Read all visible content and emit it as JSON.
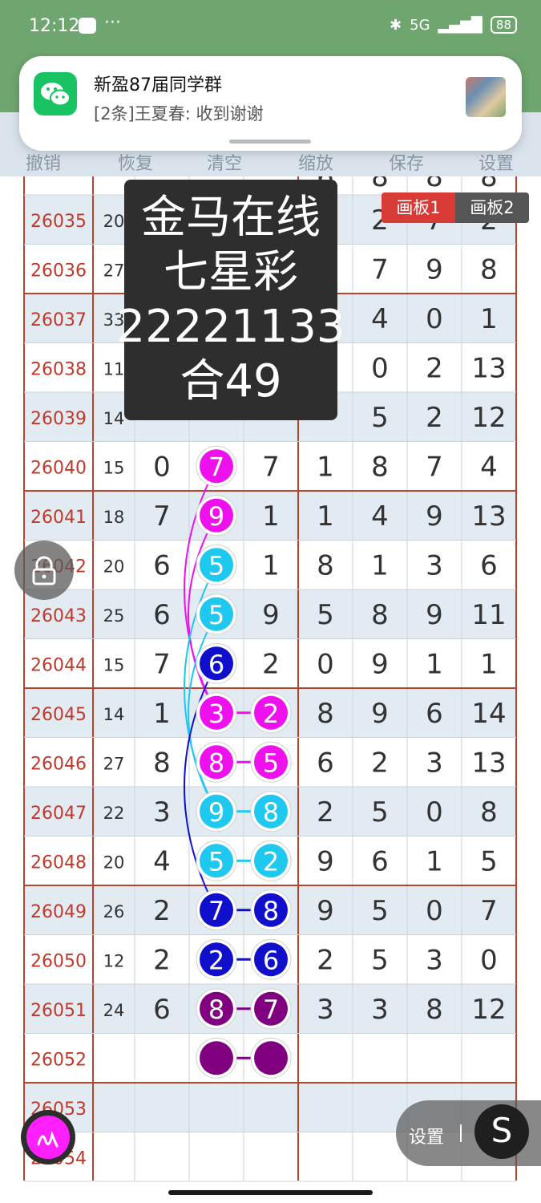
{
  "status_bar": {
    "time": "12:12",
    "more": "···",
    "signal": "5G",
    "battery": "88"
  },
  "notification": {
    "title": "新盈87届同学群",
    "message": "[2条]王夏春: 收到谢谢"
  },
  "toolbar": {
    "items": [
      "撤销",
      "恢复",
      "清空",
      "缩放",
      "保存",
      "设置"
    ]
  },
  "tabs": [
    "画板1",
    "画板2"
  ],
  "overlay": {
    "lines": [
      "金马在线",
      "七星彩",
      "22221133",
      "合49"
    ]
  },
  "columns_partial": [
    "6",
    "8",
    "8",
    "8"
  ],
  "rows": [
    {
      "id": "26035",
      "sum": "20",
      "d": [
        "",
        "",
        "",
        "",
        "2",
        "7",
        "2"
      ]
    },
    {
      "id": "26036",
      "sum": "27",
      "d": [
        "",
        "",
        "",
        "",
        "7",
        "9",
        "8"
      ]
    },
    {
      "id": "26037",
      "sum": "33",
      "d": [
        "",
        "",
        "",
        "",
        "4",
        "0",
        "1"
      ]
    },
    {
      "id": "26038",
      "sum": "11",
      "d": [
        "",
        "",
        "",
        "",
        "0",
        "2",
        "13"
      ]
    },
    {
      "id": "26039",
      "sum": "14",
      "d": [
        "",
        "",
        "",
        "",
        "5",
        "2",
        "12"
      ]
    },
    {
      "id": "26040",
      "sum": "15",
      "d": [
        "0",
        "7",
        "7",
        "1",
        "8",
        "7",
        "4"
      ]
    },
    {
      "id": "26041",
      "sum": "18",
      "d": [
        "7",
        "9",
        "1",
        "1",
        "4",
        "9",
        "13"
      ]
    },
    {
      "id": "26042",
      "sum": "20",
      "d": [
        "6",
        "5",
        "1",
        "8",
        "1",
        "3",
        "6"
      ]
    },
    {
      "id": "26043",
      "sum": "25",
      "d": [
        "6",
        "5",
        "9",
        "5",
        "8",
        "9",
        "11"
      ]
    },
    {
      "id": "26044",
      "sum": "15",
      "d": [
        "7",
        "6",
        "2",
        "0",
        "9",
        "1",
        "1"
      ]
    },
    {
      "id": "26045",
      "sum": "14",
      "d": [
        "1",
        "3",
        "2",
        "8",
        "9",
        "6",
        "14"
      ]
    },
    {
      "id": "26046",
      "sum": "27",
      "d": [
        "8",
        "8",
        "5",
        "6",
        "2",
        "3",
        "13"
      ]
    },
    {
      "id": "26047",
      "sum": "22",
      "d": [
        "3",
        "9",
        "8",
        "2",
        "5",
        "0",
        "8"
      ]
    },
    {
      "id": "26048",
      "sum": "20",
      "d": [
        "4",
        "5",
        "2",
        "9",
        "6",
        "1",
        "5"
      ]
    },
    {
      "id": "26049",
      "sum": "26",
      "d": [
        "2",
        "7",
        "8",
        "9",
        "5",
        "0",
        "7"
      ]
    },
    {
      "id": "26050",
      "sum": "12",
      "d": [
        "2",
        "2",
        "6",
        "2",
        "5",
        "3",
        "0"
      ]
    },
    {
      "id": "26051",
      "sum": "24",
      "d": [
        "6",
        "8",
        "7",
        "3",
        "3",
        "8",
        "12"
      ]
    },
    {
      "id": "26052",
      "sum": "",
      "d": [
        "",
        "",
        "",
        "",
        "",
        "",
        ""
      ]
    },
    {
      "id": "26053",
      "sum": "",
      "d": [
        "",
        "",
        "",
        "",
        "",
        "",
        ""
      ]
    },
    {
      "id": "26054",
      "sum": "",
      "d": [
        "",
        "",
        "",
        "",
        "",
        "",
        ""
      ]
    }
  ],
  "circles_col2": [
    {
      "row": 5,
      "num": "7",
      "color": "#ee11ee"
    },
    {
      "row": 6,
      "num": "9",
      "color": "#ee11ee"
    },
    {
      "row": 7,
      "num": "5",
      "color": "#1ec8ee"
    },
    {
      "row": 8,
      "num": "5",
      "color": "#1ec8ee"
    },
    {
      "row": 9,
      "num": "6",
      "color": "#1010cc"
    },
    {
      "row": 10,
      "num": "3",
      "color": "#ee11ee"
    },
    {
      "row": 11,
      "num": "8",
      "color": "#ee11ee"
    },
    {
      "row": 12,
      "num": "9",
      "color": "#1ec8ee"
    },
    {
      "row": 13,
      "num": "5",
      "color": "#1ec8ee"
    },
    {
      "row": 14,
      "num": "7",
      "color": "#1010cc"
    },
    {
      "row": 15,
      "num": "2",
      "color": "#1010cc"
    },
    {
      "row": 16,
      "num": "8",
      "color": "#800080"
    },
    {
      "row": 17,
      "num": "",
      "color": "#800080"
    }
  ],
  "circles_col3": [
    {
      "row": 10,
      "num": "2",
      "color": "#ee11ee"
    },
    {
      "row": 11,
      "num": "5",
      "color": "#ee11ee"
    },
    {
      "row": 12,
      "num": "8",
      "color": "#1ec8ee"
    },
    {
      "row": 13,
      "num": "2",
      "color": "#1ec8ee"
    },
    {
      "row": 14,
      "num": "8",
      "color": "#1010cc"
    },
    {
      "row": 15,
      "num": "6",
      "color": "#1010cc"
    },
    {
      "row": 16,
      "num": "7",
      "color": "#800080"
    },
    {
      "row": 17,
      "num": "",
      "color": "#800080"
    }
  ],
  "float_bar": {
    "label": "设置",
    "button": "S"
  },
  "colors": {
    "row_id": "#c0392b",
    "row_alt": "#e3ebf2",
    "border": "#b5452e",
    "accent_tab": "#d83a36"
  }
}
